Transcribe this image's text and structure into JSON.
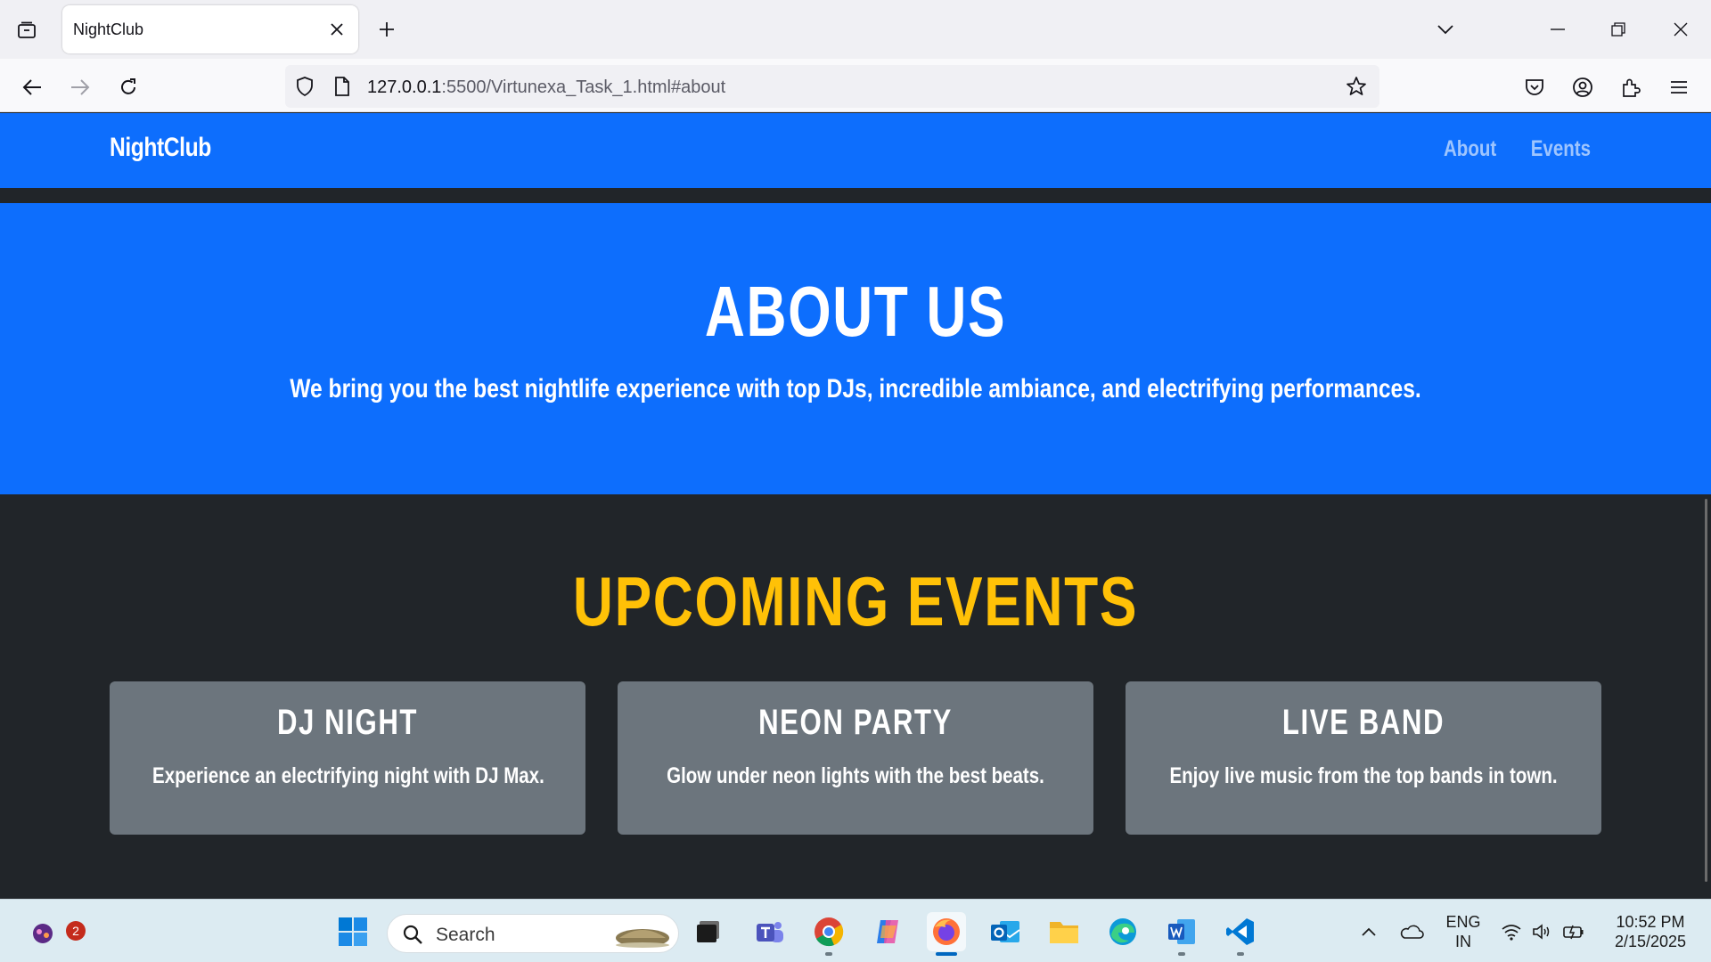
{
  "browser": {
    "tab_title": "NightClub",
    "url_host": "127.0.0.1",
    "url_path": ":5500/Virtunexa_Task_1.html#about"
  },
  "site": {
    "brand": "NightClub",
    "nav_links": [
      "About",
      "Events"
    ],
    "about": {
      "title": "ABOUT US",
      "text": "We bring you the best nightlife experience with top DJs, incredible ambiance, and electrifying performances."
    },
    "events": {
      "title": "UPCOMING EVENTS",
      "cards": [
        {
          "title": "DJ NIGHT",
          "text": "Experience an electrifying night with DJ Max."
        },
        {
          "title": "NEON PARTY",
          "text": "Glow under neon lights with the best beats."
        },
        {
          "title": "LIVE BAND",
          "text": "Enjoy live music from the top bands in town."
        }
      ]
    },
    "colors": {
      "primary": "#0d6efd",
      "dark": "#212529",
      "accent": "#ffc107",
      "card": "#6c757d"
    }
  },
  "taskbar": {
    "search_label": "Search",
    "notification_count": "2",
    "language": "ENG",
    "region": "IN",
    "time": "10:52 PM",
    "date": "2/15/2025",
    "apps": [
      "copilot-icon",
      "start-icon",
      "task-view-icon",
      "teams-icon",
      "chrome-icon",
      "copilot-app-icon",
      "firefox-icon",
      "outlook-icon",
      "file-explorer-icon",
      "edge-icon",
      "word-icon",
      "vscode-icon"
    ]
  }
}
